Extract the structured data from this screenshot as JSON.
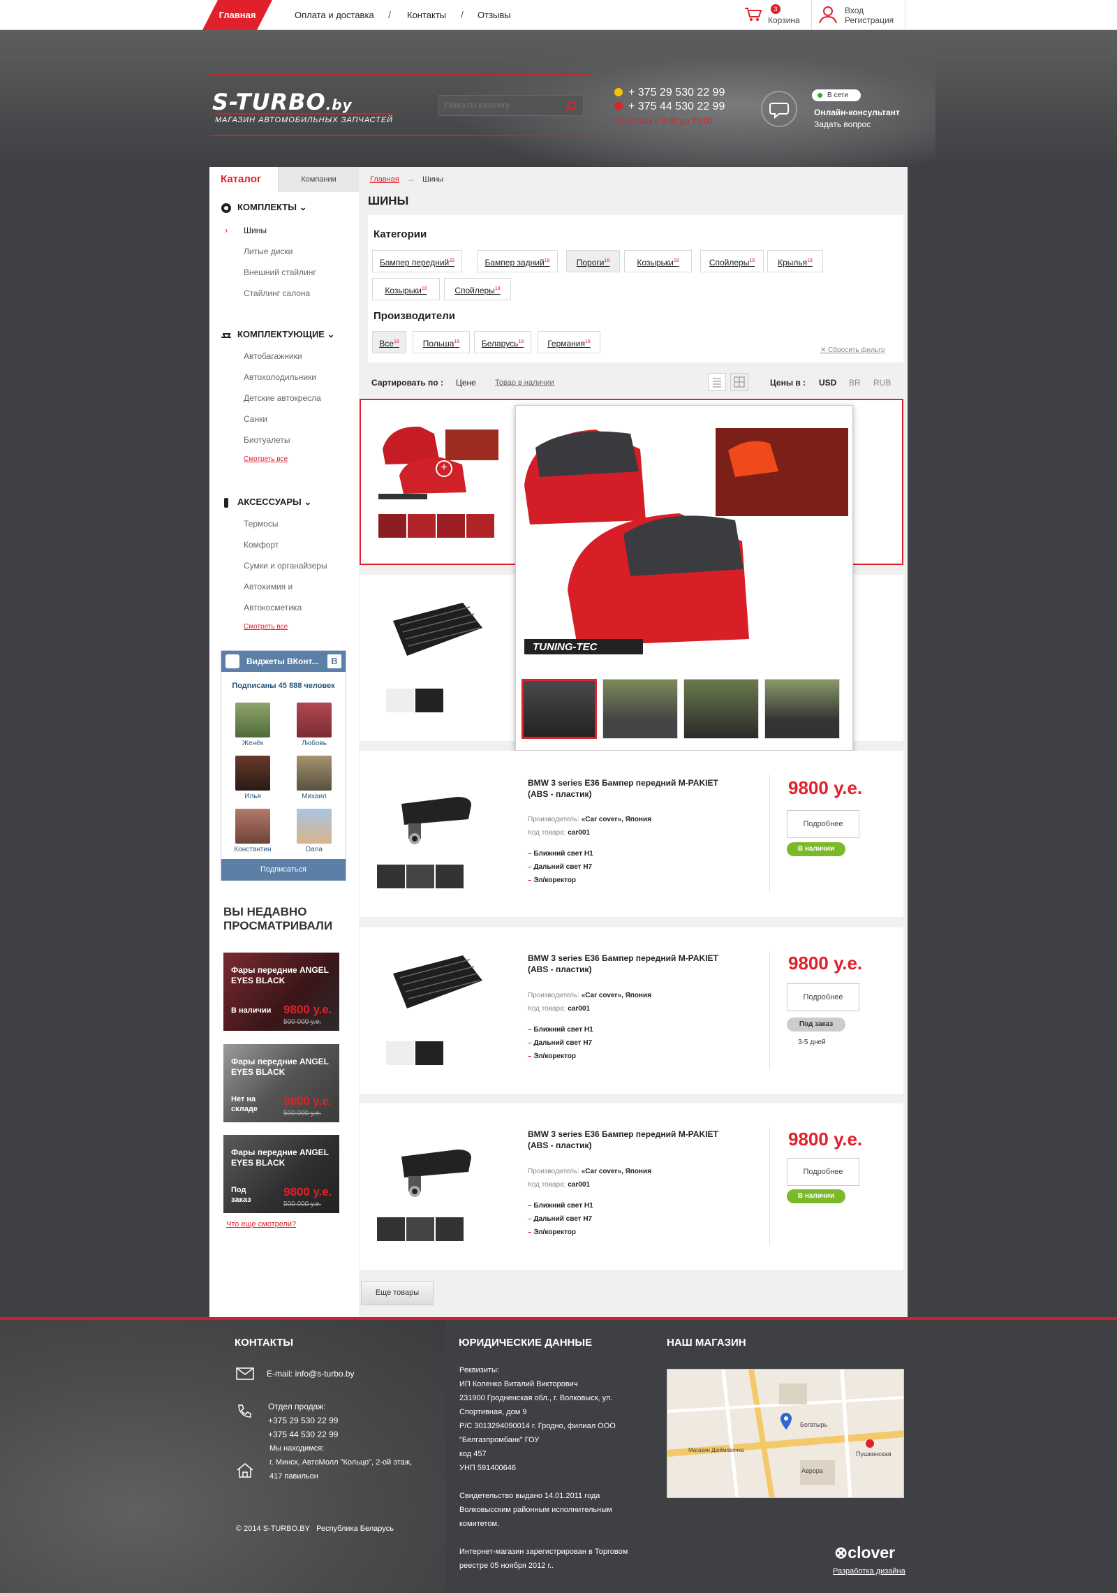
{
  "topnav": {
    "home": "Главная",
    "links": [
      "Оплата и доставка",
      "Контакты",
      "Отзывы"
    ],
    "cart_count": "3",
    "cart_label": "Корзина",
    "login": "Вход",
    "register": "Регистрация"
  },
  "header": {
    "logo": "S-TURBO",
    "logo_suffix": ".by",
    "tagline": "МАГАЗИН АВТОМОБИЛЬНЫХ ЗАПЧАСТЕЙ",
    "search_placeholder": "Поиск по каталогу",
    "phones": [
      "+ 375 29 530 22 99",
      "+ 375 44 530 22 99"
    ],
    "hours": "Работаем с 9.00 до 20.00",
    "online_status": "В сети",
    "consultant": "Онлайн-консультант",
    "ask": "Задать вопрос"
  },
  "sidebar": {
    "tab_catalog": "Каталог",
    "tab_companies": "Компании",
    "sections": [
      {
        "title": "КОМПЛЕКТЫ",
        "items": [
          "Шины",
          "Литые диски",
          "Внешний стайлинг",
          "Стайлинг салона"
        ]
      },
      {
        "title": "КОМПЛЕКТУЮЩИЕ",
        "items": [
          "Автобагажники",
          "Автохолодильники",
          "Детские автокресла",
          "Санки",
          "Биотуалеты"
        ],
        "see_all": "Смотреть все"
      },
      {
        "title": "АКСЕССУАРЫ",
        "items": [
          "Термосы",
          "Комфорт",
          "Сумки и органайзеры",
          "Автохимия и",
          "Автокосметика"
        ],
        "see_all": "Смотреть все"
      }
    ],
    "vk": {
      "title": "Виджеты ВКонт...",
      "subs": "Подписаны 45 888 человек",
      "members": [
        "Женёк",
        "Любовь",
        "Илья",
        "Михаил",
        "Константин",
        "Daria"
      ],
      "subscribe": "Подписаться"
    },
    "recent": {
      "title_line1": "ВЫ НЕДАВНО",
      "title_line2": "ПРОСМАТРИВАЛИ",
      "items": [
        {
          "title": "Фары передние ANGEL EYES BLACK",
          "status": "В наличии",
          "price": "9800 у.е.",
          "old": "500 000 у.е."
        },
        {
          "title": "Фары передние ANGEL EYES BLACK",
          "status": "Нет на складе",
          "price": "9800 у.е.",
          "old": "500 000 у.е."
        },
        {
          "title": "Фары передние ANGEL EYES BLACK",
          "status": "Под заказ",
          "price": "9800 у.е.",
          "old": "500 000 у.е."
        }
      ],
      "what_else": "Что еще смотрели?"
    }
  },
  "content": {
    "breadcrumb_home": "Главная",
    "breadcrumb_current": "Шины",
    "title": "ШИНЫ",
    "categories_label": "Категории",
    "categories": [
      {
        "label": "Бампер передний",
        "count": "33"
      },
      {
        "label": "Бампер задний",
        "count": "18"
      },
      {
        "label": "Пороги",
        "count": "18"
      },
      {
        "label": "Козырьки",
        "count": "18"
      },
      {
        "label": "Спойлеры",
        "count": "18"
      },
      {
        "label": "Крылья",
        "count": "18"
      },
      {
        "label": "Козырьки",
        "count": "18"
      },
      {
        "label": "Спойлеры",
        "count": "18"
      }
    ],
    "makers_label": "Производители",
    "makers": [
      {
        "label": "Все",
        "count": "18"
      },
      {
        "label": "Польша",
        "count": "18"
      },
      {
        "label": "Беларусь",
        "count": "18"
      },
      {
        "label": "Германия",
        "count": "18"
      }
    ],
    "reset": "Сбросить фильтр",
    "sort_label": "Сартировать по :",
    "sort_price": "Цене",
    "sort_avail": "Товар в наличии",
    "currency_label": "Цены в :",
    "currencies": [
      "USD",
      "BR",
      "RUB"
    ],
    "products": [
      {
        "title": "BMW 3 series E36 Бампер передний M-PAKIET (ABS - пластик)",
        "maker_label": "Производитель:",
        "maker": "«Car cover», Япония",
        "code_label": "Код товара:",
        "code": "car001",
        "features": [
          "Ближний свет H1",
          "Дальний свет H7",
          "Эл/коректор"
        ],
        "price": "9800 у.е.",
        "more": "Подробнее",
        "stock": "В наличии"
      },
      {
        "title": "BMW 3 series E36 Бампер передний M-PAKIET (ABS - пластик)",
        "maker_label": "Производитель:",
        "maker": "«Car cover», Япония",
        "code_label": "Код товара:",
        "code": "car001",
        "features": [
          "Ближний свет H1",
          "Дальний свет H7",
          "Эл/коректор"
        ],
        "price": "9800 у.е.",
        "more": "Подробнее",
        "stock": "Под заказ",
        "days": "3-5 дней"
      },
      {
        "title": "BMW 3 series E36 Бампер передний M-PAKIET (ABS - пластик)",
        "maker_label": "Производитель:",
        "maker": "«Car cover», Япония",
        "code_label": "Код товара:",
        "code": "car001",
        "features": [
          "Ближний свет H1",
          "Дальний свет H7",
          "Эл/коректор"
        ],
        "price": "9800 у.е.",
        "more": "Подробнее",
        "stock": "В наличии"
      }
    ],
    "popup_brand": "TUNING-TEC",
    "more_products": "Еще товары"
  },
  "footer": {
    "contacts_title": "КОНТАКТЫ",
    "email": "E-mail: info@s-turbo.by",
    "sales_label": "Отдел продаж:",
    "sales_phones": [
      "+375 29 530 22 99",
      "+375 44 530 22 99"
    ],
    "location_label": "Мы находимся:",
    "location": [
      "г. Минск, АвтоМолл \"Кольцо\", 2-ой этаж,",
      "417 павильон"
    ],
    "copyright": "© 2014 S-TURBO.BY",
    "country": "Республика Беларусь",
    "legal_title": "ЮРИДИЧЕСКИЕ ДАННЫЕ",
    "legal": [
      "Реквизиты:",
      "ИП Коленко Виталий Викторович",
      "231900 Гродненская обл., г. Волковыск, ул.",
      "Спортивная, дом 9",
      "Р/С 3013294090014 г. Гродно, филиал ООО",
      "\"Белгазпромбанк\" ГОУ",
      "код 457",
      "УНП 591400646",
      "",
      "Свидетельство выдано 14.01.2011 года",
      "Волковысским районным исполнительным",
      "комитетом.",
      "",
      "Интернет-магазин зарегистрирован в Торговом",
      "реестре 05 ноября 2012 г.."
    ],
    "shop_title": "НАШ МАГАЗИН",
    "map_labels": [
      "Богатырь",
      "Пушкинская",
      "Магазин Дюймовочка",
      "Аврора"
    ],
    "clover": "clover",
    "clover_sub": "Разработка дизайна"
  }
}
